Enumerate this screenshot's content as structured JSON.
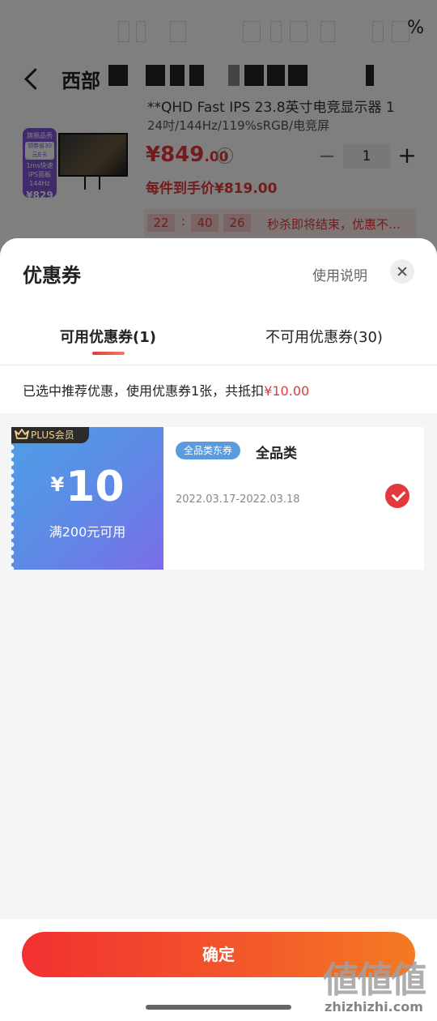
{
  "status_bar": {
    "battery_text": "%"
  },
  "nav": {
    "title": "西部"
  },
  "product": {
    "title_fragment": "**QHD Fast IPS 23.8英寸电竞显示器 1",
    "spec": "24吋/144Hz/119%sRGB/电竞屏",
    "promo_card": {
      "headline": "旗舰品秀",
      "badge": "领券省30元E卡",
      "size_label": "1ms快速",
      "panel": "IPS面板144Hz",
      "price": "¥829"
    },
    "price_symbol": "¥",
    "price_main": "849",
    "price_decimal": ".00",
    "info_glyph": "i",
    "quantity": "1",
    "qty_minus": "−",
    "qty_plus": "+",
    "per_piece_label": "每件到手价¥819.00",
    "countdown": {
      "hours": "22",
      "minutes": "40",
      "seconds": "26",
      "sep": ":",
      "text": "秒杀即将结束，优惠不…"
    }
  },
  "sheet": {
    "title": "优惠券",
    "help_label": "使用说明",
    "tabs": [
      {
        "label": "可用优惠券(1)",
        "active": true
      },
      {
        "label": "不可用优惠券(30)",
        "active": false
      }
    ],
    "summary": {
      "prefix": "已选中推荐优惠，使用优惠券1张，共抵扣",
      "amount": "¥10.00"
    },
    "coupons": [
      {
        "badge": "PLUS会员",
        "currency": "¥",
        "value": "10",
        "condition": "满200元可用",
        "tag": "全品类东券",
        "name": "全品类",
        "date_range": "2022.03.17-2022.03.18",
        "selected": true
      }
    ],
    "confirm_label": "确定"
  },
  "watermark": {
    "logo": "値値値",
    "url": "zhizhizhi.com"
  },
  "colors": {
    "accent": "#e4393c",
    "coupon_blue": "#5f88e6",
    "tag_blue": "#5a9be0"
  }
}
